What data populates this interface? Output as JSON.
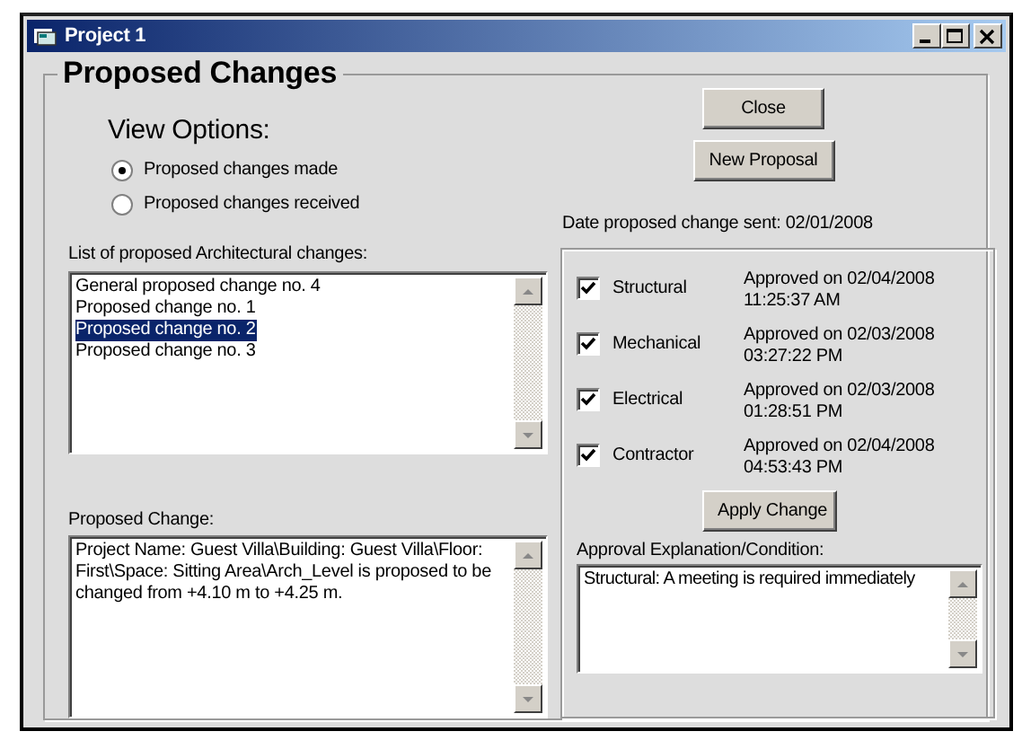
{
  "window": {
    "title": "Project 1"
  },
  "heading": "Proposed Changes",
  "view_options": {
    "title": "View Options:",
    "options": [
      {
        "label": "Proposed changes made",
        "selected": true
      },
      {
        "label": "Proposed changes received",
        "selected": false
      }
    ]
  },
  "close_button": "Close",
  "new_proposal_button": "New Proposal",
  "changes_list": {
    "label": "List of proposed Architectural changes:",
    "items": [
      {
        "label": "General proposed change no. 4",
        "selected": false
      },
      {
        "label": "Proposed change no. 1",
        "selected": false
      },
      {
        "label": "Proposed change no. 2",
        "selected": true
      },
      {
        "label": "Proposed change no. 3",
        "selected": false
      }
    ]
  },
  "proposed_change": {
    "label": "Proposed Change:",
    "text": "Project Name: Guest Villa\\Building: Guest Villa\\Floor: First\\Space: Sitting Area\\Arch_Level is proposed to be changed from +4.10 m to +4.25 m."
  },
  "date_sent": "Date proposed change sent: 02/01/2008",
  "approvals": [
    {
      "discipline": "Structural",
      "checked": true,
      "status": "Approved on 02/04/2008",
      "time": "11:25:37 AM"
    },
    {
      "discipline": "Mechanical",
      "checked": true,
      "status": "Approved on 02/03/2008",
      "time": "03:27:22 PM"
    },
    {
      "discipline": "Electrical",
      "checked": true,
      "status": "Approved on 02/03/2008",
      "time": "01:28:51 PM"
    },
    {
      "discipline": "Contractor",
      "checked": true,
      "status": "Approved on 02/04/2008",
      "time": "04:53:43 PM"
    }
  ],
  "apply_button": "Apply Change",
  "approval_explanation": {
    "label": "Approval Explanation/Condition:",
    "text": "Structural: A meeting is required immediately"
  }
}
